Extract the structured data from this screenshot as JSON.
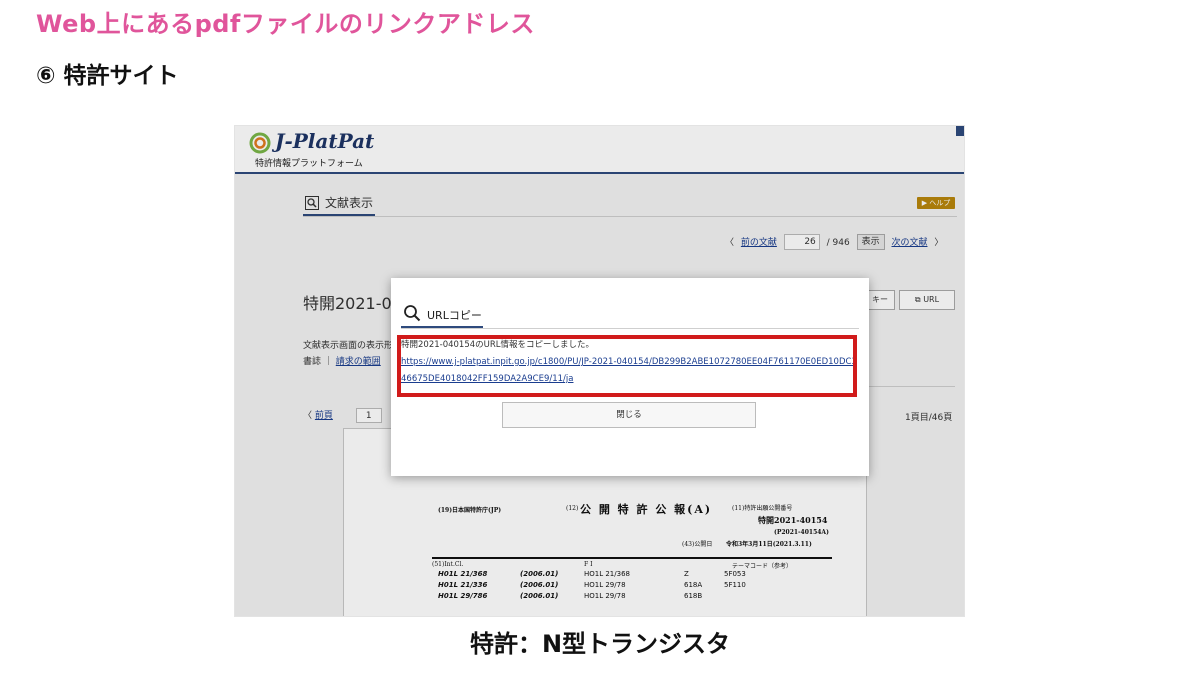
{
  "slide": {
    "title": "Web上にあるpdfファイルのリンクアドレス",
    "subtitle": "⑥ 特許サイト",
    "caption": "特許：N型トランジスタ"
  },
  "site": {
    "logo_text": "J-PlatPat",
    "logo_sub": "特許情報プラットフォーム",
    "panel_title": "文献表示",
    "help": "▶ ヘルプ",
    "pager": {
      "prev": "前の文献",
      "current": "26",
      "total": "/ 946",
      "show": "表示",
      "next": "次の文献"
    },
    "doc_number": "特開2021-04",
    "key_btn": "キー",
    "url_btn": "URL",
    "range_label": "文献表示画面の表示形",
    "range_prefix": "書誌 ｜",
    "range_link": "請求の範囲",
    "page_prev": "前頁",
    "page_input": "1",
    "page_count": "1頁目/46頁"
  },
  "gazette": {
    "office": "(19)日本国特許庁(JP)",
    "kind": "(12)",
    "kind_title": "公 開 特 許 公 報(A)",
    "pub_label": "(11)特許出願公開番号",
    "pub_number": "特開2021-40154",
    "pub_alt": "(P2021-40154A)",
    "pub_date_label": "(43)公開日",
    "pub_date": "令和3年3月11日(2021.3.11)",
    "intcl": "(51)Int.Cl.",
    "fi": "F I",
    "theme": "テーマコード（参考）",
    "rows": [
      {
        "cls": "H01L 21/368",
        "ver": "(2006.01)",
        "fi": "HO1L 21/368",
        "z": "Z",
        "code": "5F053"
      },
      {
        "cls": "H01L 21/336",
        "ver": "(2006.01)",
        "fi": "HO1L 29/78",
        "z": "618A",
        "code": "5F110"
      },
      {
        "cls": "H01L 29/786",
        "ver": "(2006.01)",
        "fi": "HO1L 29/78",
        "z": "618B",
        "code": ""
      }
    ]
  },
  "dialog": {
    "title": "URLコピー",
    "message": "特開2021-040154のURL情報をコピーしました。",
    "url": "https://www.j-platpat.inpit.go.jp/c1800/PU/JP-2021-040154/DB299B2ABE1072780EE04F761170E0ED10DC346675DE4018042FF159DA2A9CE9/11/ja",
    "close": "閉じる"
  },
  "colors": {
    "title_pink": "#e0559b",
    "highlight_red": "#d11b1b",
    "link_blue": "#1a3d8f",
    "brand_navy": "#2e4a7d"
  }
}
